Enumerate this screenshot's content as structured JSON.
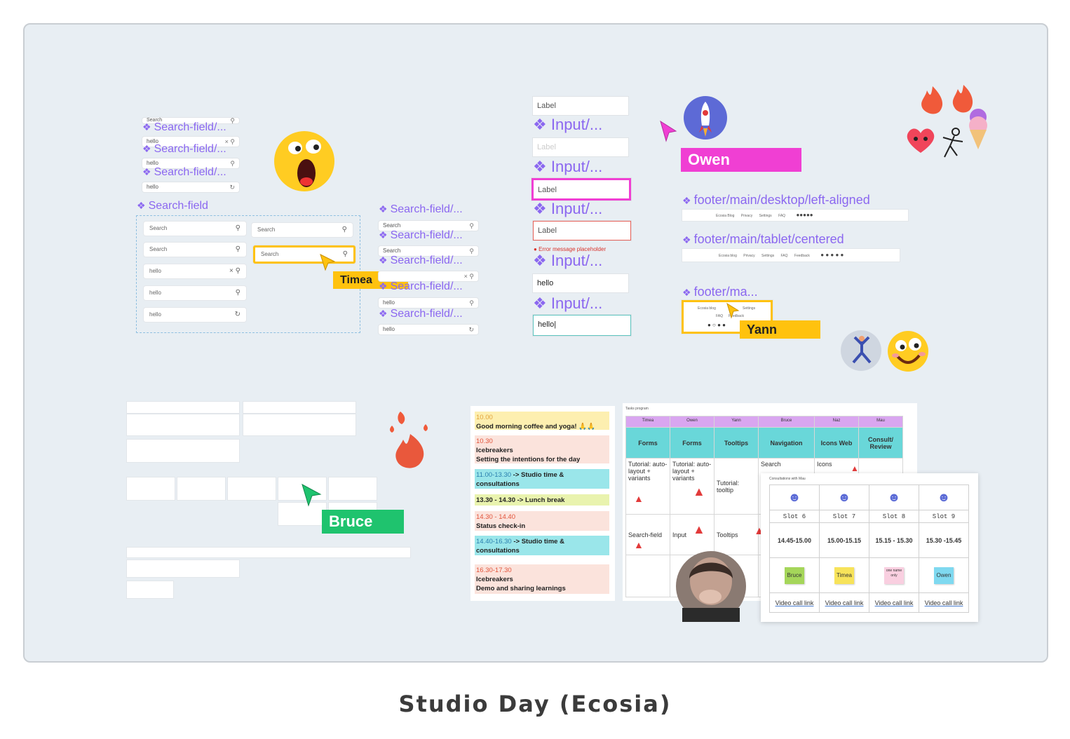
{
  "caption": "Studio Day (Ecosia)",
  "search_components": {
    "stack": [
      {
        "label": "Search-field/...",
        "value": "Search",
        "icon": "search-icon"
      },
      {
        "label": "Search-field/...",
        "value": "hello",
        "icon": "clear-search-icon"
      },
      {
        "label": "Search-field/...",
        "value": "hello",
        "icon": "search-icon"
      },
      {
        "label": "",
        "value": "hello",
        "icon": "loading-icon"
      }
    ],
    "group_label": "Search-field",
    "group_fields": [
      {
        "value": "Search"
      },
      {
        "value": "Search"
      },
      {
        "value": "hello"
      },
      {
        "value": "hello"
      },
      {
        "value": "hello"
      }
    ],
    "right_fields": [
      {
        "value": "Search"
      },
      {
        "value": "Search"
      }
    ],
    "column": [
      {
        "label": "Search-field/...",
        "value": "Search"
      },
      {
        "label": "Search-field/...",
        "value": "Search"
      },
      {
        "label": "Search-field/...",
        "value": ""
      },
      {
        "label": "Search-field/...",
        "value": "hello"
      },
      {
        "label": "Search-field/...",
        "value": "hello"
      }
    ]
  },
  "inputs": {
    "label_text": "Label",
    "component_label": "Input/...",
    "error_text": "Error message placeholder",
    "value_text": "hello"
  },
  "footers": {
    "desktop": "footer/main/desktop/left-aligned",
    "tablet": "footer/main/tablet/centered",
    "mobile": "footer/ma...",
    "desktop_links": [
      "Ecosia Blog",
      "Privacy",
      "Settings",
      "FAQ"
    ],
    "tablet_links": [
      "Ecosia blog",
      "Privacy",
      "Settings",
      "FAQ",
      "Feedback"
    ],
    "mobile_links": [
      "Ecosia blog",
      "Settings",
      "FAQ",
      "Feedback"
    ]
  },
  "cursors": {
    "timea": {
      "name": "Timea",
      "color": "#ffc20e"
    },
    "owen": {
      "name": "Owen",
      "color": "#f03fd3"
    },
    "yann": {
      "name": "Yann",
      "color": "#ffc20e"
    },
    "bruce": {
      "name": "Bruce",
      "color": "#1fc36e"
    }
  },
  "schedule": [
    {
      "time": "10.00",
      "text": "Good morning coffee and yoga! 🙏🙏",
      "bg": "#fdefb0"
    },
    {
      "time": "10.30",
      "text": "Icebreakers",
      "text2": "Setting the intentions for the day",
      "bg": "#fbe3dc"
    },
    {
      "time": "11.00-13.30",
      "text": "-> Studio time & consultations",
      "bg": "#9ae6ea"
    },
    {
      "time": "",
      "text": "13.30 - 14.30 -> Lunch break",
      "bg": "#e9f3ae"
    },
    {
      "time": "14.30 - 14.40",
      "text": "Status check-in",
      "bg": "#fbe3dc"
    },
    {
      "time": "14.40-16.30",
      "text": "-> Studio time & consultations",
      "bg": "#9ae6ea"
    },
    {
      "time": "16.30-17.30",
      "text": "Icebreakers",
      "text2": "Demo and sharing learnings",
      "bg": "#fbe3dc"
    }
  ],
  "tasks": {
    "title": "Tasks program",
    "names": [
      "Timea",
      "Owen",
      "Yann",
      "Bruce",
      "Naz",
      "Mau"
    ],
    "topics": [
      "Forms",
      "Forms",
      "Tooltips",
      "Navigation",
      "Icons Web",
      "Consult/ Review"
    ],
    "row1": [
      "Tutorial: auto-layout + variants",
      "Tutorial: auto-layout + variants",
      "Tutorial: tooltip",
      "Search",
      "Icons",
      ""
    ],
    "row2": [
      "Search-field",
      "Input",
      "Tooltips",
      "",
      "",
      ""
    ]
  },
  "consultations": {
    "title": "Consultations with Mau",
    "slots": [
      "Slot 6",
      "Slot 7",
      "Slot 8",
      "Slot 9"
    ],
    "times": [
      "14.45-15.00",
      "15.00-15.15",
      "15.15 - 15.30",
      "15.30 -15.45"
    ],
    "stickies": [
      {
        "text": "Bruce",
        "color": "#a5d65a"
      },
      {
        "text": "Timea",
        "color": "#f7e35a"
      },
      {
        "text": "one name only",
        "color": "#f9cfe0"
      },
      {
        "text": "Owen",
        "color": "#7fd9f0"
      }
    ],
    "link_text": "Video call link"
  }
}
